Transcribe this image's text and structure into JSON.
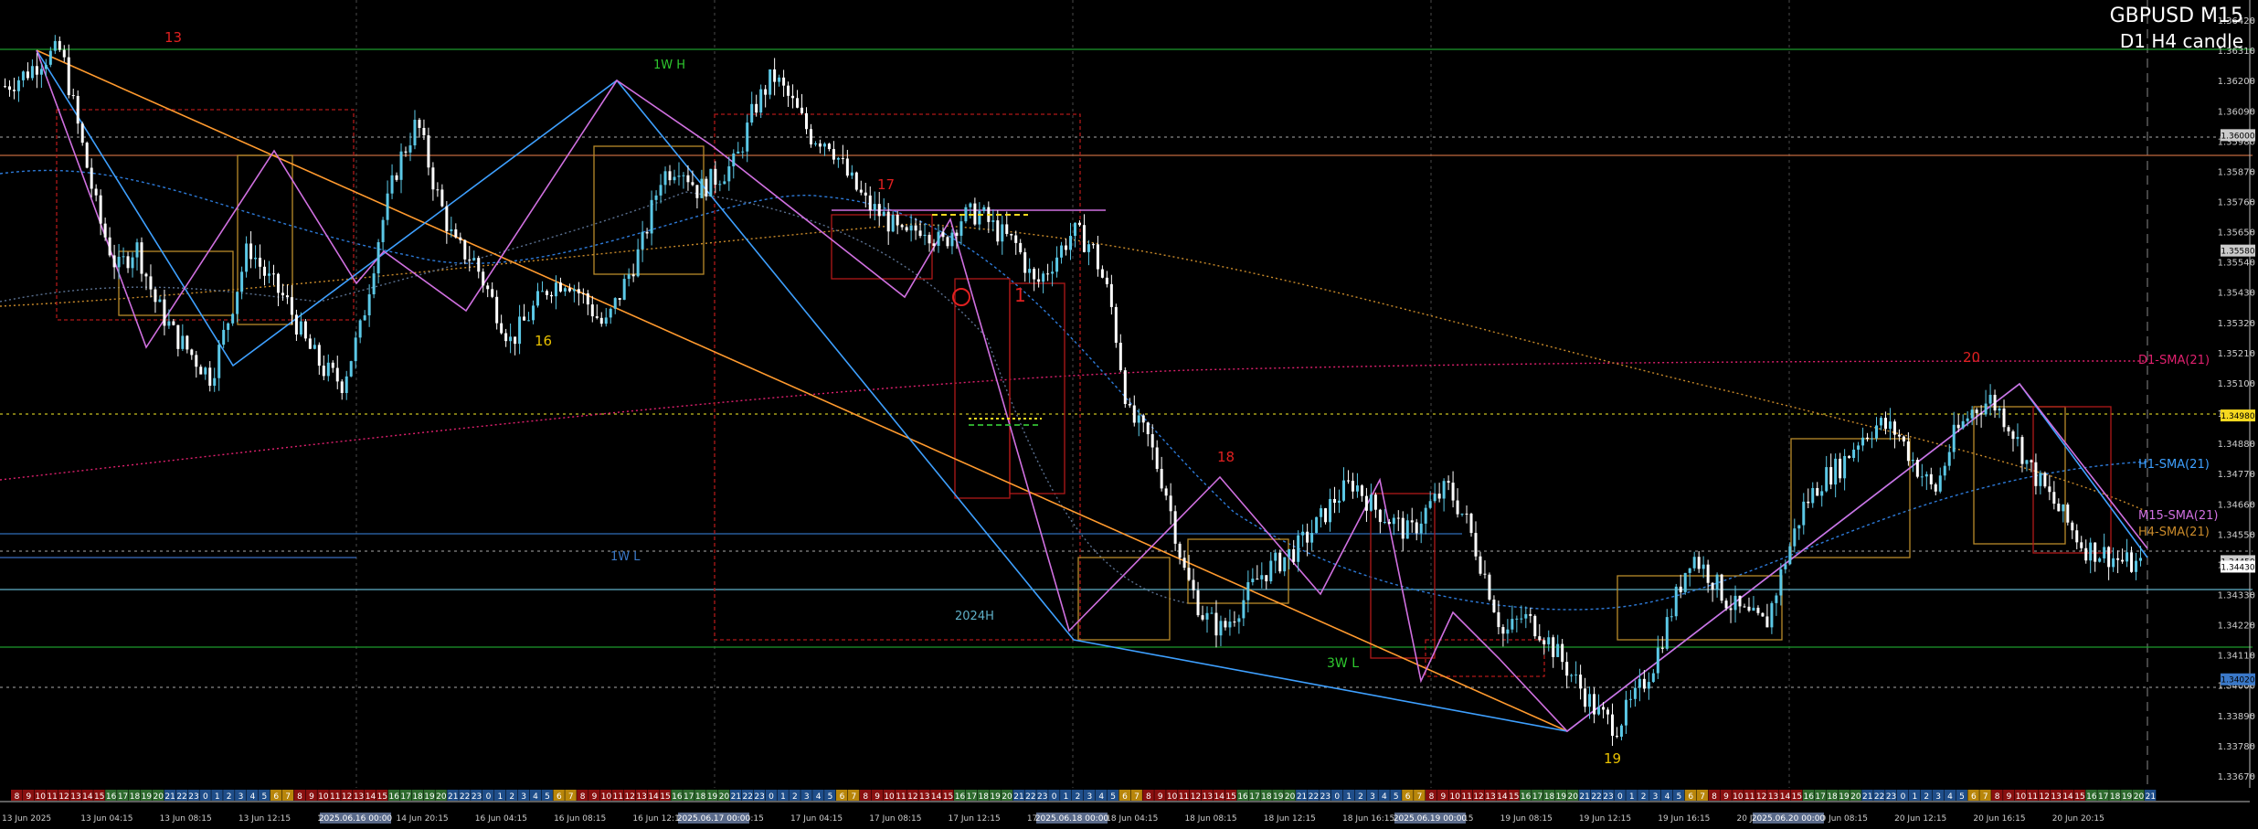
{
  "window": {
    "symbol_tf": "GBPUSD M15",
    "subtitle": "D1 H4 candle"
  },
  "colors": {
    "background": "#000000",
    "bull": "#5bc8e6",
    "bear": "#ffffff",
    "grid": "#3a3a3a",
    "zigzag_blue": "#3ea0ff",
    "zigzag_pink": "#d070e0",
    "trend_orange": "#ff9a2e",
    "h1_sma": "#2d7ad8",
    "d1_sma": "#e0206e",
    "h4_sma": "#c98a2a",
    "m15_sma": "#7a8aa0"
  },
  "chart_data": {
    "type": "candlestick",
    "instrument": "GBPUSD",
    "timeframe": "M15",
    "ylim": [
      1.3364,
      1.3648
    ],
    "y_ticks": [
      "1.36420",
      "1.36310",
      "1.36200",
      "1.36090",
      "1.35980",
      "1.35870",
      "1.35760",
      "1.35650",
      "1.35540",
      "1.35430",
      "1.35320",
      "1.35210",
      "1.35100",
      "1.34990",
      "1.34880",
      "1.34770",
      "1.34660",
      "1.34550",
      "1.34440",
      "1.34330",
      "1.34220",
      "1.34110",
      "1.34000",
      "1.33890",
      "1.33780",
      "1.33670"
    ],
    "price_tags": [
      "1.36000",
      "1.35580",
      "1.34980",
      "1.34450",
      "1.34020"
    ],
    "current_price": "1.34430",
    "x_labels": [
      "13 Jun 2025",
      "13 Jun 04:15",
      "13 Jun 08:15",
      "13 Jun 12:15",
      "13 Jun 16:15",
      "14 Jun 20:15",
      "16 Jun 04:15",
      "16 Jun 08:15",
      "16 Jun 12:15",
      "16 Jun 16:15",
      "17 Jun 04:15",
      "17 Jun 08:15",
      "17 Jun 12:15",
      "17 Jun 16:15",
      "18 Jun 04:15",
      "18 Jun 08:15",
      "18 Jun 12:15",
      "18 Jun 16:15",
      "19 Jun 04:15",
      "19 Jun 08:15",
      "19 Jun 12:15",
      "19 Jun 16:15",
      "20 Jun 04:15",
      "20 Jun 08:15",
      "20 Jun 12:15",
      "20 Jun 16:15",
      "20 Jun 20:15"
    ],
    "x_highlight_labels": [
      "2025.06.16 00:00",
      "2025.06.17 00:00",
      "2025.06.18 00:00",
      "2025.06.19 00:00",
      "2025.06.20 00:00"
    ],
    "hour_strip": [
      "8",
      "9",
      "10",
      "11",
      "12",
      "13",
      "14",
      "15",
      "16",
      "17",
      "18",
      "19",
      "20",
      "21",
      "22",
      "23",
      "0",
      "1",
      "2",
      "3",
      "4",
      "5",
      "6",
      "7"
    ],
    "legend": [
      "D1-SMA(21)",
      "H1-SMA(21)",
      "M15-SMA(21)",
      "H4-SMA(21)"
    ],
    "annotations": {
      "labels": [
        "1W H",
        "1W L",
        "2024H",
        "3W L",
        "1"
      ],
      "wave_counts": [
        "13",
        "16",
        "17",
        "18",
        "19",
        "20"
      ]
    },
    "key_prices": {
      "weekly_high": 1.3631,
      "weekly_low": 1.344,
      "three_week_low": 1.3415,
      "h2024": 1.3435
    },
    "series_close": [
      1.3618,
      1.3622,
      1.3628,
      1.3631,
      1.36,
      1.357,
      1.3551,
      1.356,
      1.354,
      1.3528,
      1.352,
      1.3512,
      1.3535,
      1.356,
      1.3548,
      1.354,
      1.3525,
      1.3515,
      1.351,
      1.353,
      1.3565,
      1.359,
      1.3605,
      1.358,
      1.356,
      1.3555,
      1.354,
      1.3525,
      1.3535,
      1.3545,
      1.3548,
      1.354,
      1.353,
      1.3545,
      1.356,
      1.3585,
      1.359,
      1.358,
      1.3585,
      1.359,
      1.361,
      1.3622,
      1.3612,
      1.36,
      1.3598,
      1.3585,
      1.3575,
      1.357,
      1.3562,
      1.3568,
      1.356,
      1.357,
      1.3572,
      1.3565,
      1.356,
      1.3545,
      1.3555,
      1.3565,
      1.356,
      1.354,
      1.3498,
      1.349,
      1.347,
      1.344,
      1.3425,
      1.342,
      1.343,
      1.344,
      1.3445,
      1.345,
      1.3458,
      1.3468,
      1.3474,
      1.3465,
      1.346,
      1.3455,
      1.3465,
      1.3472,
      1.346,
      1.344,
      1.3418,
      1.3425,
      1.342,
      1.341,
      1.34,
      1.339,
      1.3385,
      1.3395,
      1.3408,
      1.3428,
      1.3448,
      1.344,
      1.343,
      1.3425,
      1.3422,
      1.3445,
      1.3465,
      1.3475,
      1.348,
      1.349,
      1.3495,
      1.3492,
      1.348,
      1.347,
      1.349,
      1.35,
      1.3504,
      1.3495,
      1.348,
      1.347,
      1.346,
      1.345,
      1.3448,
      1.3445,
      1.3443
    ]
  }
}
